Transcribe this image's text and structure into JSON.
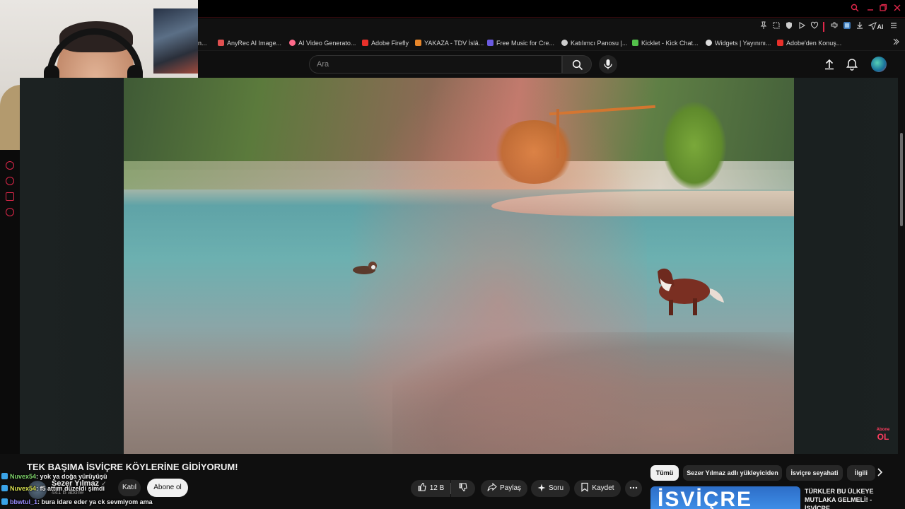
{
  "browser": {
    "bookmarks": [
      {
        "label": "n...",
        "color": "#444444"
      },
      {
        "label": "AnyRec AI Image...",
        "color": "#e05050"
      },
      {
        "label": "AI Video Generato...",
        "color": "#ff6a8a"
      },
      {
        "label": "Adobe Firefly",
        "color": "#e8302a"
      },
      {
        "label": "YAKAZA - TDV İslâ...",
        "color": "#e8862a"
      },
      {
        "label": "Free Music for Cre...",
        "color": "#6a5ae0"
      },
      {
        "label": "Katılımcı Panosu |...",
        "color": "#cccccc"
      },
      {
        "label": "Kicklet - Kick Chat...",
        "color": "#53c04a"
      },
      {
        "label": "Widgets | Yayınını...",
        "color": "#dddddd"
      },
      {
        "label": "Adobe'den Konuş...",
        "color": "#e8302a"
      }
    ],
    "toolbar_ai": "AI",
    "accent": "#e0274a"
  },
  "header": {
    "search_placeholder": "Ara"
  },
  "video": {
    "title": "TEK BAŞIMA İSVİÇRE KÖYLERİNE GİDİYORUM!",
    "channel": "Sezer Yılmaz",
    "subscribers": "441 B abone",
    "join_label": "Katıl",
    "subscribe_label": "Abone ol",
    "like_count": "12 B",
    "share_label": "Paylaş",
    "ask_label": "Soru",
    "save_label": "Kaydet",
    "overlay_top": "Abone",
    "overlay_bottom": "OL"
  },
  "chat": [
    {
      "user": "Nuvex54",
      "message": ": yok ya doğa yürüyüşü"
    },
    {
      "user": "Nuvex54",
      "message": ": f5 attım düzeldi şimdi"
    },
    {
      "user": "bbwtul_1",
      "message": ": bura idare eder ya ck sevmiyom ama"
    }
  ],
  "recommendations": {
    "chips": [
      "Tümü",
      "Sezer Yılmaz adlı yükleyiciden",
      "İsviçre seyahati",
      "İlgili"
    ],
    "thumb_text": "İSVİÇRE",
    "first_title": "TÜRKLER BU ÜLKEYE MUTLAKA GELMELİ! - İSVİÇRE"
  }
}
